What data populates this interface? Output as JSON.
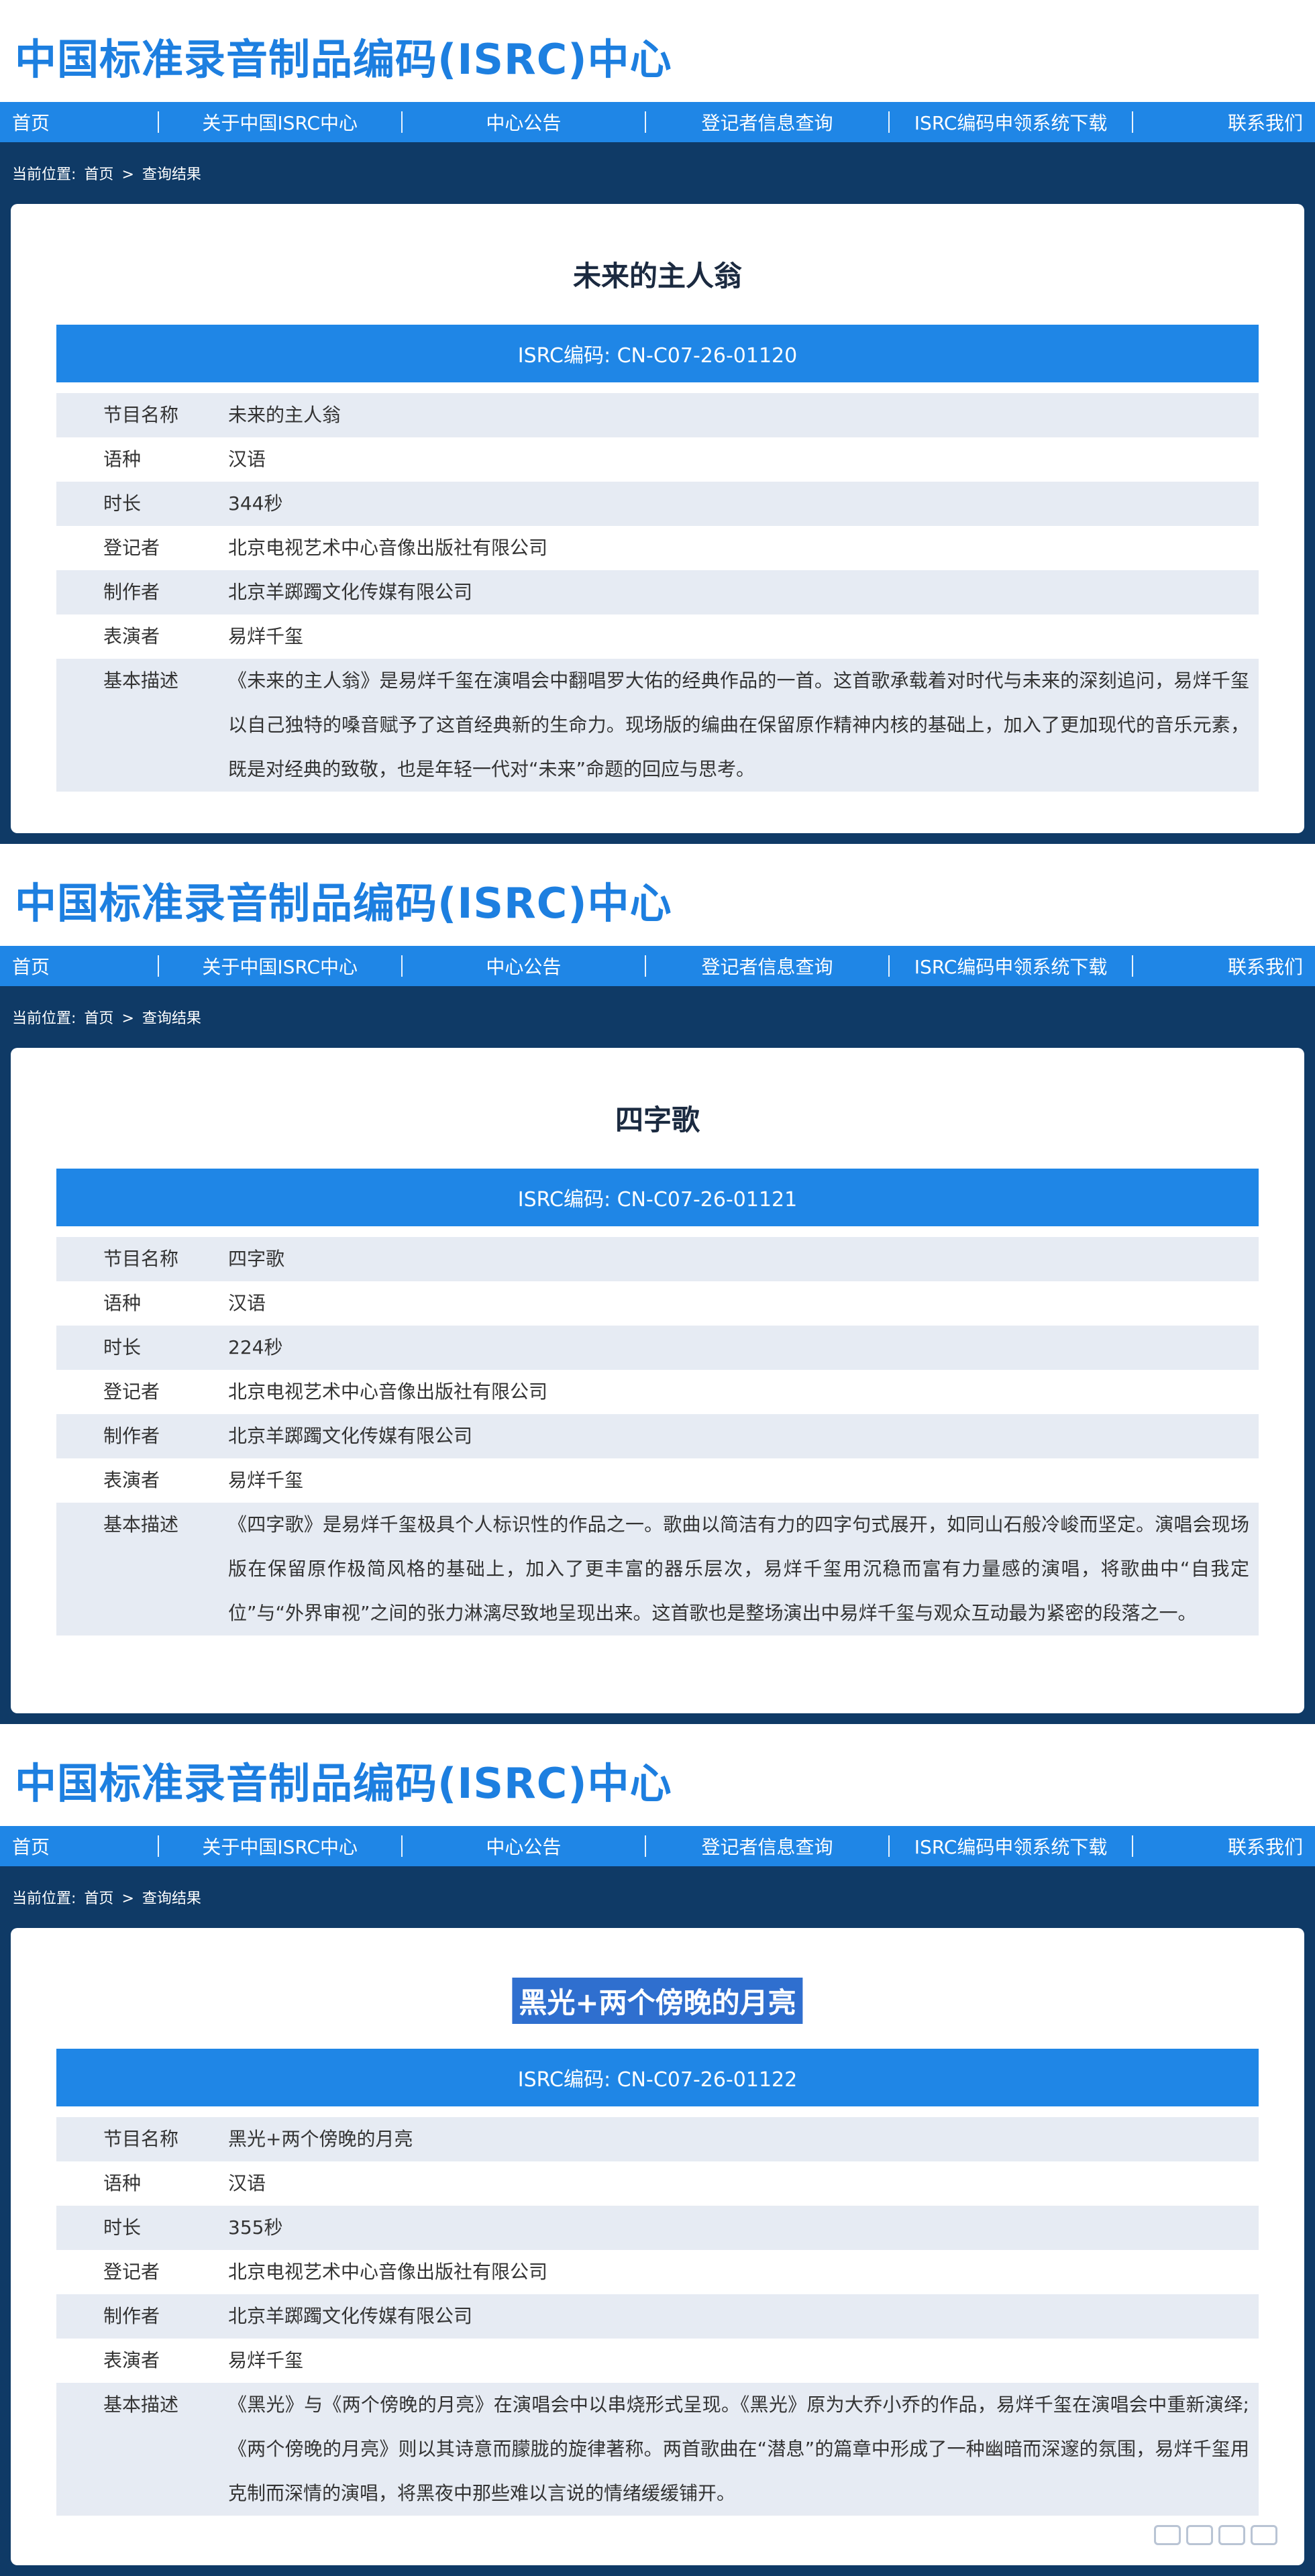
{
  "site_title": "中国标准录音制品编码(ISRC)中心",
  "nav": [
    "首页",
    "关于中国ISRC中心",
    "中心公告",
    "登记者信息查询",
    "ISRC编码申领系统下载",
    "联系我们"
  ],
  "breadcrumb": {
    "label": "当前位置:",
    "home": "首页",
    "sep": ">",
    "current": "查询结果"
  },
  "field_labels": [
    "节目名称",
    "语种",
    "时长",
    "登记者",
    "制作者",
    "表演者",
    "基本描述"
  ],
  "records": [
    {
      "title": "未来的主人翁",
      "isrc": "ISRC编码:  CN-C07-26-01120",
      "values": [
        "未来的主人翁",
        "汉语",
        "344秒",
        "北京电视艺术中心音像出版社有限公司",
        "北京羊踯躅文化传媒有限公司",
        "易烊千玺",
        "《未来的主人翁》是易烊千玺在演唱会中翻唱罗大佑的经典作品的一首。这首歌承载着对时代与未来的深刻追问，易烊千玺以自己独特的嗓音赋予了这首经典新的生命力。现场版的编曲在保留原作精神内核的基础上，加入了更加现代的音乐元素，既是对经典的致敬，也是年轻一代对“未来”命题的回应与思考。"
      ]
    },
    {
      "title": "四字歌",
      "isrc": "ISRC编码:  CN-C07-26-01121",
      "values": [
        "四字歌",
        "汉语",
        "224秒",
        "北京电视艺术中心音像出版社有限公司",
        "北京羊踯躅文化传媒有限公司",
        "易烊千玺",
        "《四字歌》是易烊千玺极具个人标识性的作品之一。歌曲以简洁有力的四字句式展开，如同山石般冷峻而坚定。演唱会现场版在保留原作极简风格的基础上，加入了更丰富的器乐层次，易烊千玺用沉稳而富有力量感的演唱，将歌曲中“自我定位”与“外界审视”之间的张力淋漓尽致地呈现出来。这首歌也是整场演出中易烊千玺与观众互动最为紧密的段落之一。"
      ]
    },
    {
      "title": "黑光+两个傍晚的月亮",
      "isrc": "ISRC编码:  CN-C07-26-01122",
      "values": [
        "黑光+两个傍晚的月亮",
        "汉语",
        "355秒",
        "北京电视艺术中心音像出版社有限公司",
        "北京羊踯躅文化传媒有限公司",
        "易烊千玺",
        "《黑光》与《两个傍晚的月亮》在演唱会中以串烧形式呈现。《黑光》原为大乔小乔的作品，易烊千玺在演唱会中重新演绎;《两个傍晚的月亮》则以其诗意而朦胧的旋律著称。两首歌曲在“潜息”的篇章中形成了一种幽暗而深邃的氛围，易烊千玺用克制而深情的演唱，将黑夜中那些难以言说的情绪缓缓铺开。"
      ]
    }
  ]
}
